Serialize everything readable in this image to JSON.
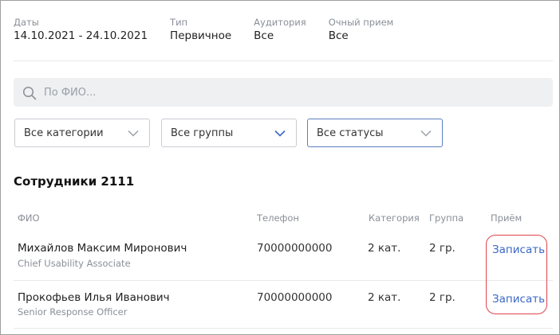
{
  "info": [
    {
      "label": "Даты",
      "value": "14.10.2021 - 24.10.2021"
    },
    {
      "label": "Тип",
      "value": "Первичное"
    },
    {
      "label": "Аудитория",
      "value": "Все"
    },
    {
      "label": "Очный прием",
      "value": "Все"
    }
  ],
  "search": {
    "placeholder": "По ФИО..."
  },
  "filters": {
    "category": "Все категории",
    "group": "Все группы",
    "status": "Все статусы"
  },
  "section_title": "Сотрудники 2111",
  "table": {
    "headers": {
      "name": "ФИО",
      "phone": "Телефон",
      "category": "Категория",
      "group": "Группа",
      "reception": "Приём"
    },
    "rows": [
      {
        "name": "Михайлов Максим Миронович",
        "position": "Chief Usability Associate",
        "phone": "70000000000",
        "category": "2 кат.",
        "group": "2 гр.",
        "action": "Записать"
      },
      {
        "name": "Прокофьев Илья Иванович",
        "position": "Senior Response Officer",
        "phone": "70000000000",
        "category": "2 кат.",
        "group": "2 гр.",
        "action": "Записать"
      }
    ]
  },
  "colors": {
    "link": "#3c67c4",
    "highlight": "#e0434c",
    "focused_border": "#5a7fbf"
  }
}
